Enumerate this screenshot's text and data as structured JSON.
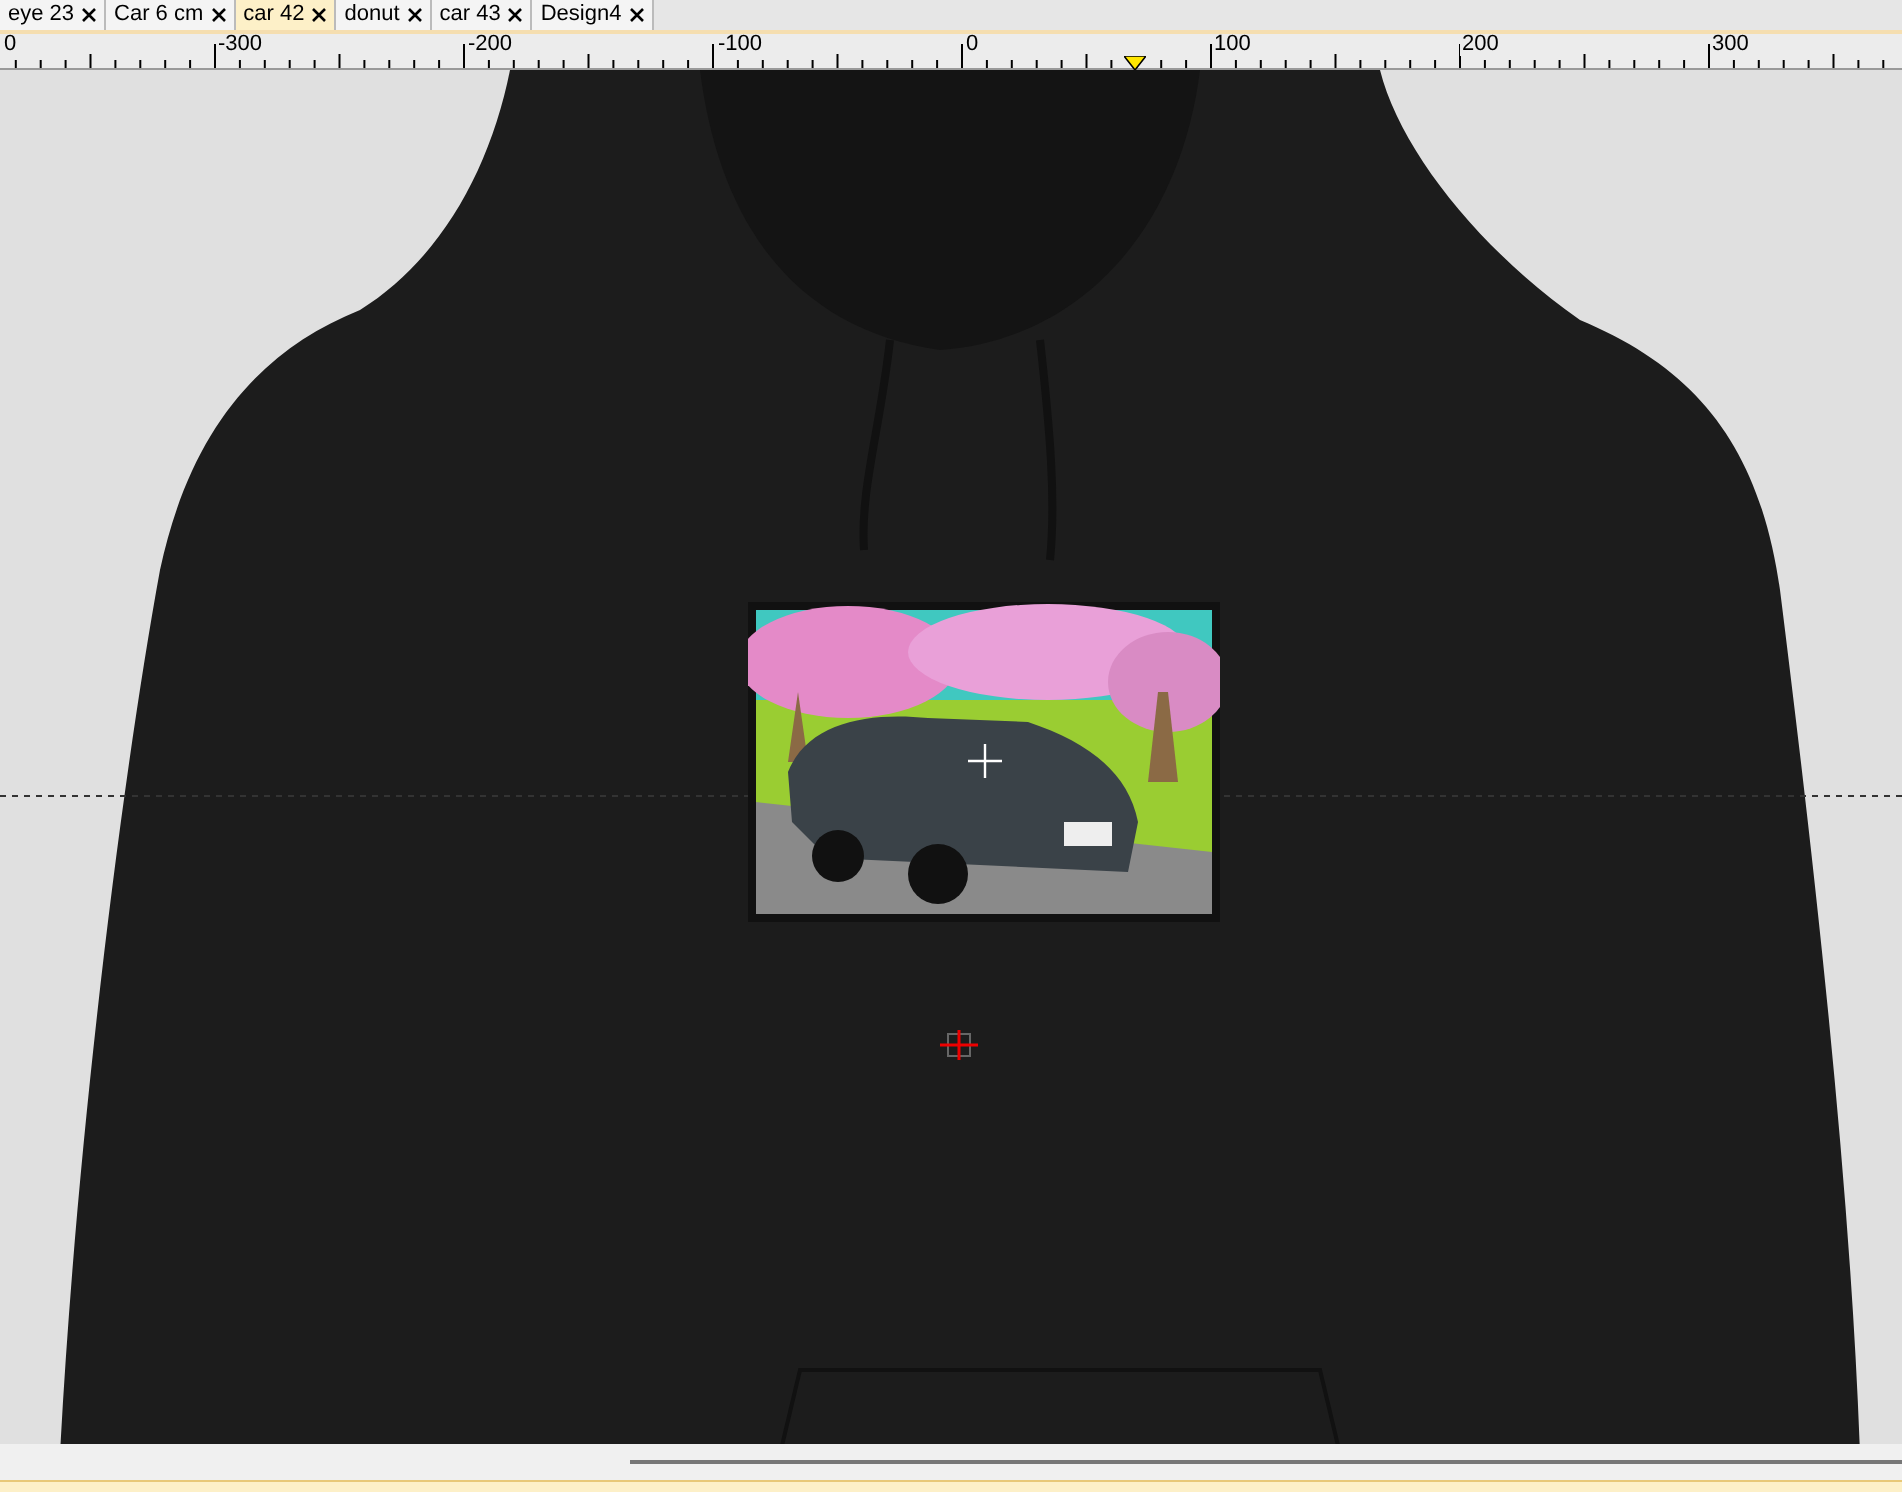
{
  "tabs": [
    {
      "label": "eye 23",
      "selected": false
    },
    {
      "label": "Car 6 cm",
      "selected": false
    },
    {
      "label": "car 42",
      "selected": true
    },
    {
      "label": "donut",
      "selected": false
    },
    {
      "label": "car 43",
      "selected": false
    },
    {
      "label": "Design4",
      "selected": false
    }
  ],
  "ruler": {
    "labels": [
      "0",
      "-300",
      "-200",
      "-100",
      "0",
      "100",
      "200",
      "300"
    ]
  }
}
